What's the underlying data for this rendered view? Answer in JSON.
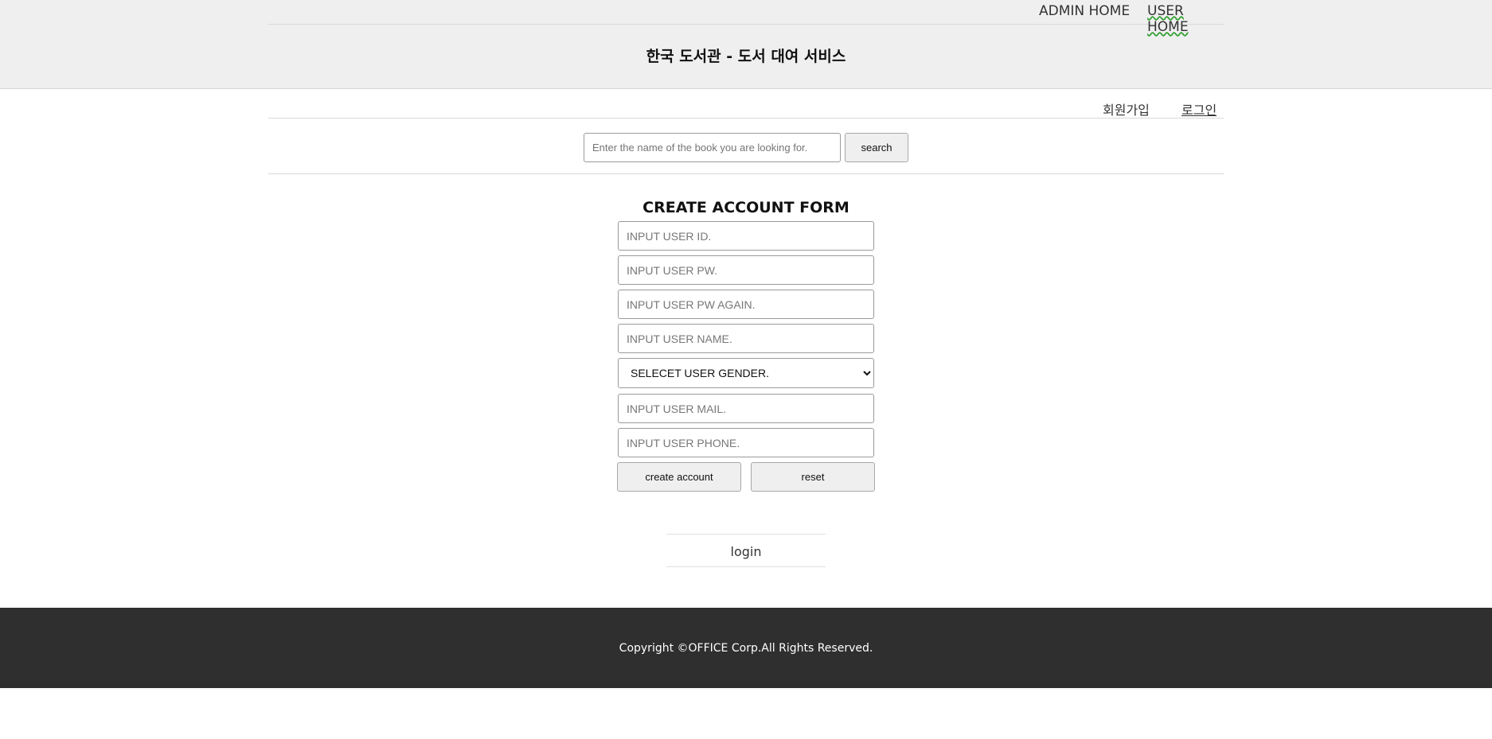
{
  "top_nav": {
    "admin_home": "ADMIN HOME",
    "user_home": "USER HOME"
  },
  "header": {
    "title": "한국 도서관 - 도서 대여 서비스"
  },
  "auth": {
    "signup": "회원가입",
    "login": "로그인"
  },
  "search": {
    "placeholder": "Enter the name of the book you are looking for.",
    "button": "search"
  },
  "form": {
    "title": "CREATE ACCOUNT FORM",
    "user_id_placeholder": "INPUT USER ID.",
    "user_pw_placeholder": "INPUT USER PW.",
    "user_pw_again_placeholder": "INPUT USER PW AGAIN.",
    "user_name_placeholder": "INPUT USER NAME.",
    "gender_selected": "SELECET USER GENDER.",
    "user_mail_placeholder": "INPUT USER MAIL.",
    "user_phone_placeholder": "INPUT USER PHONE.",
    "create_button": "create account",
    "reset_button": "reset"
  },
  "login_link": "login",
  "footer": {
    "copyright": "Copyright ©OFFICE Corp.All Rights Reserved."
  },
  "colors": {
    "header_bg": "#efefef",
    "footer_bg": "#2f2f2f",
    "button_bg": "#efefef"
  }
}
